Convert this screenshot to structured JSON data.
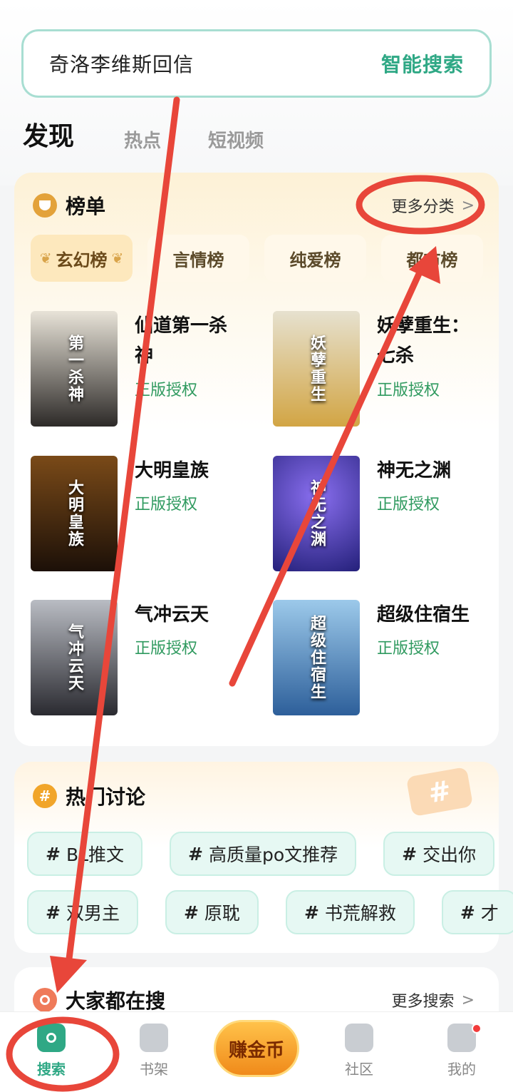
{
  "search": {
    "query": "奇洛李维斯回信",
    "smart_label": "智能搜索"
  },
  "tabs": [
    "发现",
    "热点",
    "短视频"
  ],
  "rank": {
    "title": "榜单",
    "more": "更多分类",
    "categories": [
      "玄幻榜",
      "言情榜",
      "纯爱榜",
      "都市榜"
    ],
    "books": [
      {
        "title": "仙道第一杀神",
        "tag": "正版授权",
        "cover_text": "第一杀神",
        "color": "#3a3a3a"
      },
      {
        "title": "妖孽重生：七杀",
        "tag": "正版授权",
        "cover_text": "妖孽重生",
        "color": "#c9a34a"
      },
      {
        "title": "大明皇族",
        "tag": "正版授权",
        "cover_text": "大明皇族",
        "color": "#4a2e14"
      },
      {
        "title": "神无之渊",
        "tag": "正版授权",
        "cover_text": "神无之渊",
        "color": "#2b2f8f"
      },
      {
        "title": "气冲云天",
        "tag": "正版授权",
        "cover_text": "气冲云天",
        "color": "#4a4a52"
      },
      {
        "title": "超级住宿生",
        "tag": "正版授权",
        "cover_text": "超级住宿生",
        "color": "#4f8fc9"
      }
    ]
  },
  "hot": {
    "title": "热门讨论",
    "row1": [
      "BL推文",
      "高质量po文推荐",
      "交出你"
    ],
    "row2": [
      "双男主",
      "原耽",
      "书荒解救",
      "才"
    ]
  },
  "everyone": {
    "title": "大家都在搜",
    "more": "更多搜索"
  },
  "nav": {
    "search": "搜索",
    "shelf": "书架",
    "coin": "赚金币",
    "community": "社区",
    "mine": "我的"
  },
  "colors": {
    "accent": "#2fa885",
    "arrow": "#e8463a"
  }
}
